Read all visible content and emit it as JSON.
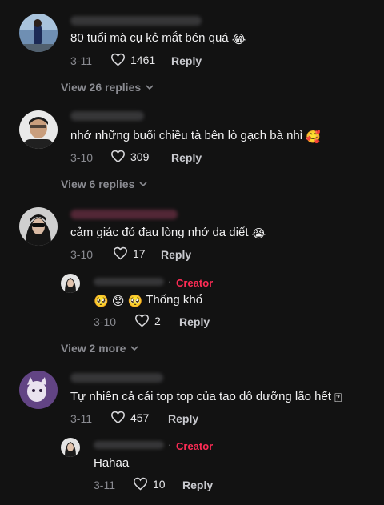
{
  "comments": [
    {
      "text": "80 tuổi mà cụ kẻ mắt bén quá",
      "emoji": "😂",
      "date": "3-11",
      "likes": "1461",
      "reply_label": "Reply",
      "view_replies": "View 26 replies"
    },
    {
      "text": "nhớ những buổi chiều tà bên lò gạch bà nhỉ",
      "emoji": "🥰",
      "date": "3-10",
      "likes": "309",
      "reply_label": "Reply",
      "view_replies": "View 6 replies"
    },
    {
      "text": "cảm giác đó đau lòng nhớ da diết",
      "emoji": "😭",
      "date": "3-10",
      "likes": "17",
      "reply_label": "Reply",
      "view_replies": "View 2 more",
      "reply": {
        "creator_label": "Creator",
        "text": "Thống khổ",
        "emoji": "🥺 😟 🥺",
        "date": "3-10",
        "likes": "2",
        "reply_label": "Reply"
      }
    },
    {
      "text": "Tự nhiên cả cái top top của tao dô dưỡng lão hết",
      "emoji": "⍰",
      "date": "3-11",
      "likes": "457",
      "reply_label": "Reply",
      "reply": {
        "creator_label": "Creator",
        "text": "Hahaa",
        "date": "3-11",
        "likes": "10",
        "reply_label": "Reply"
      }
    }
  ],
  "colors": {
    "background": "#121212",
    "creator": "#fe2c55",
    "muted": "#8a8b91"
  }
}
